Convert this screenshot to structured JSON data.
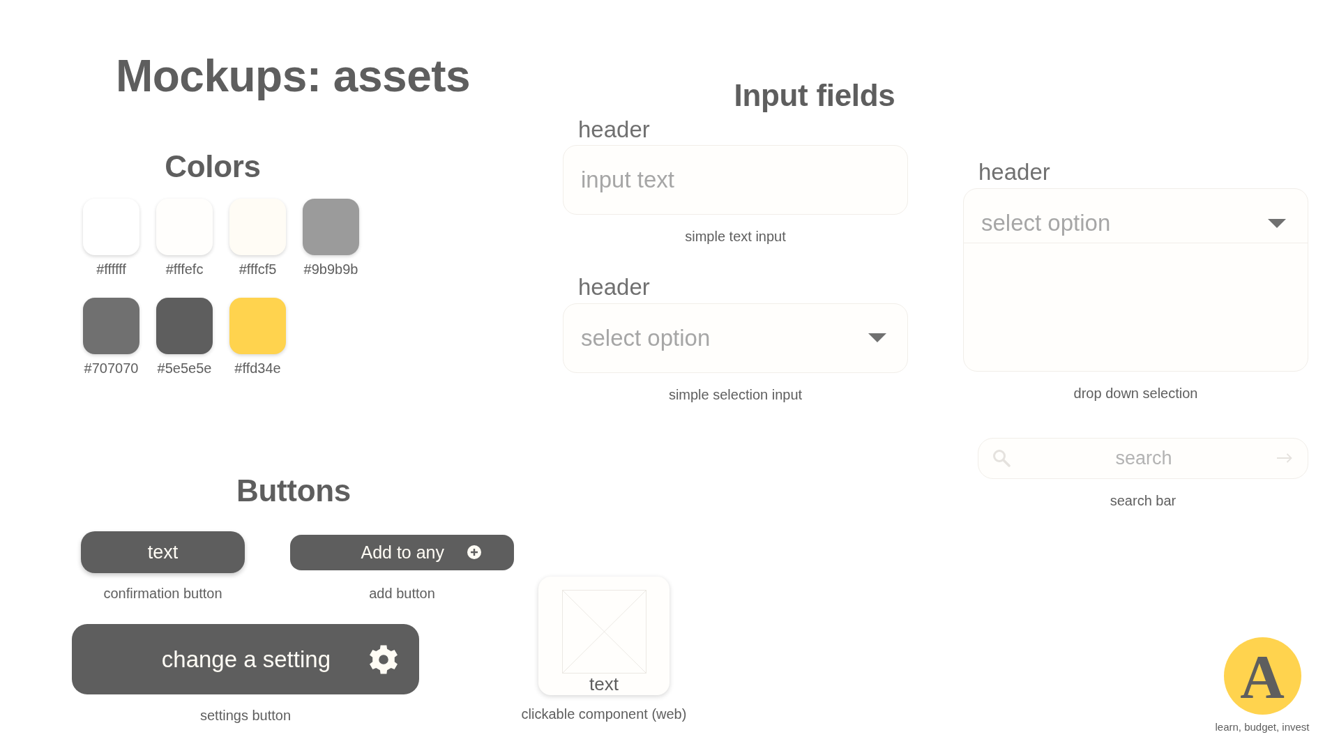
{
  "title": "Mockups: assets",
  "colors": {
    "heading": "Colors",
    "swatches": [
      {
        "label": "#ffffff",
        "color": "#ffffff"
      },
      {
        "label": "#fffefc",
        "color": "#fffefc"
      },
      {
        "label": "#fffcf5",
        "color": "#fffcf5"
      },
      {
        "label": "#9b9b9b",
        "color": "#9b9b9b"
      },
      {
        "label": "#707070",
        "color": "#707070"
      },
      {
        "label": "#5e5e5e",
        "color": "#5e5e5e"
      },
      {
        "label": "#ffd34e",
        "color": "#ffd34e"
      }
    ]
  },
  "input_fields": {
    "heading": "Input fields",
    "items": [
      {
        "kind": "text",
        "header": "header",
        "placeholder": "input text",
        "caption": "simple text input"
      },
      {
        "kind": "select",
        "header": "header",
        "placeholder": "select option",
        "caption": "simple selection input"
      },
      {
        "kind": "dropdown",
        "header": "header",
        "placeholder": "select option",
        "caption": "drop down selection"
      },
      {
        "kind": "search",
        "placeholder": "search",
        "caption": "search bar"
      }
    ]
  },
  "buttons": {
    "heading": "Buttons",
    "items": [
      {
        "kind": "confirm",
        "label": "text",
        "caption": "confirmation button"
      },
      {
        "kind": "add",
        "label": "Add to any",
        "caption": "add button"
      },
      {
        "kind": "settings",
        "label": "change a setting",
        "caption": "settings button"
      }
    ]
  },
  "clickable_component": {
    "label": "text",
    "caption": "clickable component (web)"
  },
  "logo": {
    "letter": "A",
    "tagline": "learn, budget, invest"
  }
}
